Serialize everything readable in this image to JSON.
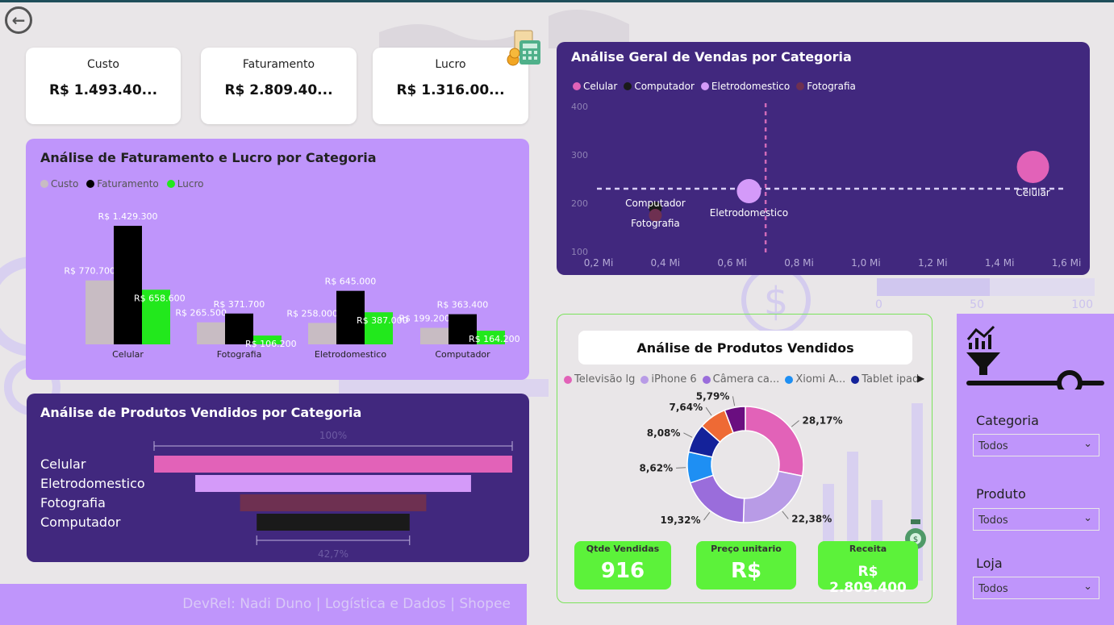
{
  "kpis": {
    "custo": {
      "label": "Custo",
      "value": "R$ 1.493.40..."
    },
    "faturamento": {
      "label": "Faturamento",
      "value": "R$ 2.809.40..."
    },
    "lucro": {
      "label": "Lucro",
      "value": "R$ 1.316.00..."
    }
  },
  "colors": {
    "custo": "#c8bcc3",
    "faturamento": "#000000",
    "lucro": "#22e81c",
    "celular": "#e262b8",
    "computador": "#1a1a1a",
    "eletrodomestico": "#d49af9",
    "fotografia": "#6e3051"
  },
  "bar_chart": {
    "title": "Análise de Faturamento e Lucro por Categoria",
    "legend": [
      "Custo",
      "Faturamento",
      "Lucro"
    ],
    "chart_data": {
      "type": "bar",
      "categories": [
        "Celular",
        "Fotografia",
        "Eletrodomestico",
        "Computador"
      ],
      "series": [
        {
          "name": "Custo",
          "values": [
            770700,
            265500,
            258000,
            199200
          ],
          "labels": [
            "R$ 770.700",
            "R$ 265.500",
            "R$ 258.000",
            "R$ 199.200"
          ]
        },
        {
          "name": "Faturamento",
          "values": [
            1429300,
            371700,
            645000,
            363400
          ],
          "labels": [
            "R$ 1.429.300",
            "R$ 371.700",
            "R$ 645.000",
            "R$ 363.400"
          ]
        },
        {
          "name": "Lucro",
          "values": [
            658600,
            106200,
            387000,
            164200
          ],
          "labels": [
            "R$ 658.600",
            "R$ 106.200",
            "R$ 387.000",
            "R$ 164.200"
          ]
        }
      ]
    }
  },
  "scatter_chart": {
    "title": "Análise Geral de Vendas por Categoria",
    "legend": [
      "Celular",
      "Computador",
      "Eletrodomestico",
      "Fotografia"
    ],
    "chart_data": {
      "type": "scatter",
      "points": [
        {
          "name": "Celular",
          "x": 1.5,
          "y": 275
        },
        {
          "name": "Eletrodomestico",
          "x": 0.65,
          "y": 225
        },
        {
          "name": "Computador",
          "x": 0.37,
          "y": 190
        },
        {
          "name": "Fotografia",
          "x": 0.37,
          "y": 175
        }
      ],
      "x_ticks": [
        "0,2 Mi",
        "0,4 Mi",
        "0,6 Mi",
        "0,8 Mi",
        "1,0 Mi",
        "1,2 Mi",
        "1,4 Mi",
        "1,6 Mi"
      ],
      "y_ticks": [
        "400",
        "300",
        "200",
        "100"
      ],
      "xlim": [
        0.2,
        1.6
      ],
      "ylim": [
        100,
        400
      ],
      "ref_x": 0.7,
      "ref_y": 230
    }
  },
  "funnel_chart": {
    "title": "Análise de Produtos Vendidos por Categoria",
    "top_label": "100%",
    "bottom_label": "42,7%",
    "chart_data": {
      "type": "bar",
      "categories": [
        "Celular",
        "Eletrodomestico",
        "Fotografia",
        "Computador"
      ],
      "values": [
        100,
        77,
        52,
        42.7
      ]
    }
  },
  "donut_chart": {
    "title": "Análise de Produtos Vendidos",
    "legend": [
      {
        "label": "Televisão lg",
        "color": "#e262b8"
      },
      {
        "label": "iPhone 6",
        "color": "#b89be6"
      },
      {
        "label": "Câmera ca...",
        "color": "#9a6ddb"
      },
      {
        "label": "Xiomi A...",
        "color": "#1e8ff3"
      },
      {
        "label": "Tablet ipad",
        "color": "#14229a"
      }
    ],
    "chart_data": {
      "type": "pie",
      "slices": [
        {
          "value": 28.17,
          "label": "28,17%",
          "color": "#e262b8"
        },
        {
          "value": 22.38,
          "label": "22,38%",
          "color": "#b89be6"
        },
        {
          "value": 19.32,
          "label": "19,32%",
          "color": "#9a6ddb"
        },
        {
          "value": 8.62,
          "label": "8,62%",
          "color": "#1e8ff3"
        },
        {
          "value": 8.08,
          "label": "8,08%",
          "color": "#14229a"
        },
        {
          "value": 7.64,
          "label": "7,64%",
          "color": "#ee6a35"
        },
        {
          "value": 5.79,
          "label": "5,79%",
          "color": "#6a0e80"
        }
      ]
    }
  },
  "stats": {
    "qtde": {
      "label": "Qtde Vendidas",
      "value": "916"
    },
    "preco": {
      "label": "Preço unitario",
      "value": "R$"
    },
    "receita": {
      "label": "Receita",
      "value": "R$ 2.809.400"
    }
  },
  "filters": {
    "categoria": {
      "label": "Categoria",
      "value": "Todos"
    },
    "produto": {
      "label": "Produto",
      "value": "Todos"
    },
    "loja": {
      "label": "Loja",
      "value": "Todos"
    }
  },
  "footer": {
    "text": "DevRel: Nadi Duno | Logística e Dados | Shopee"
  },
  "background": {
    "ticks": [
      "0",
      "50",
      "100"
    ]
  }
}
